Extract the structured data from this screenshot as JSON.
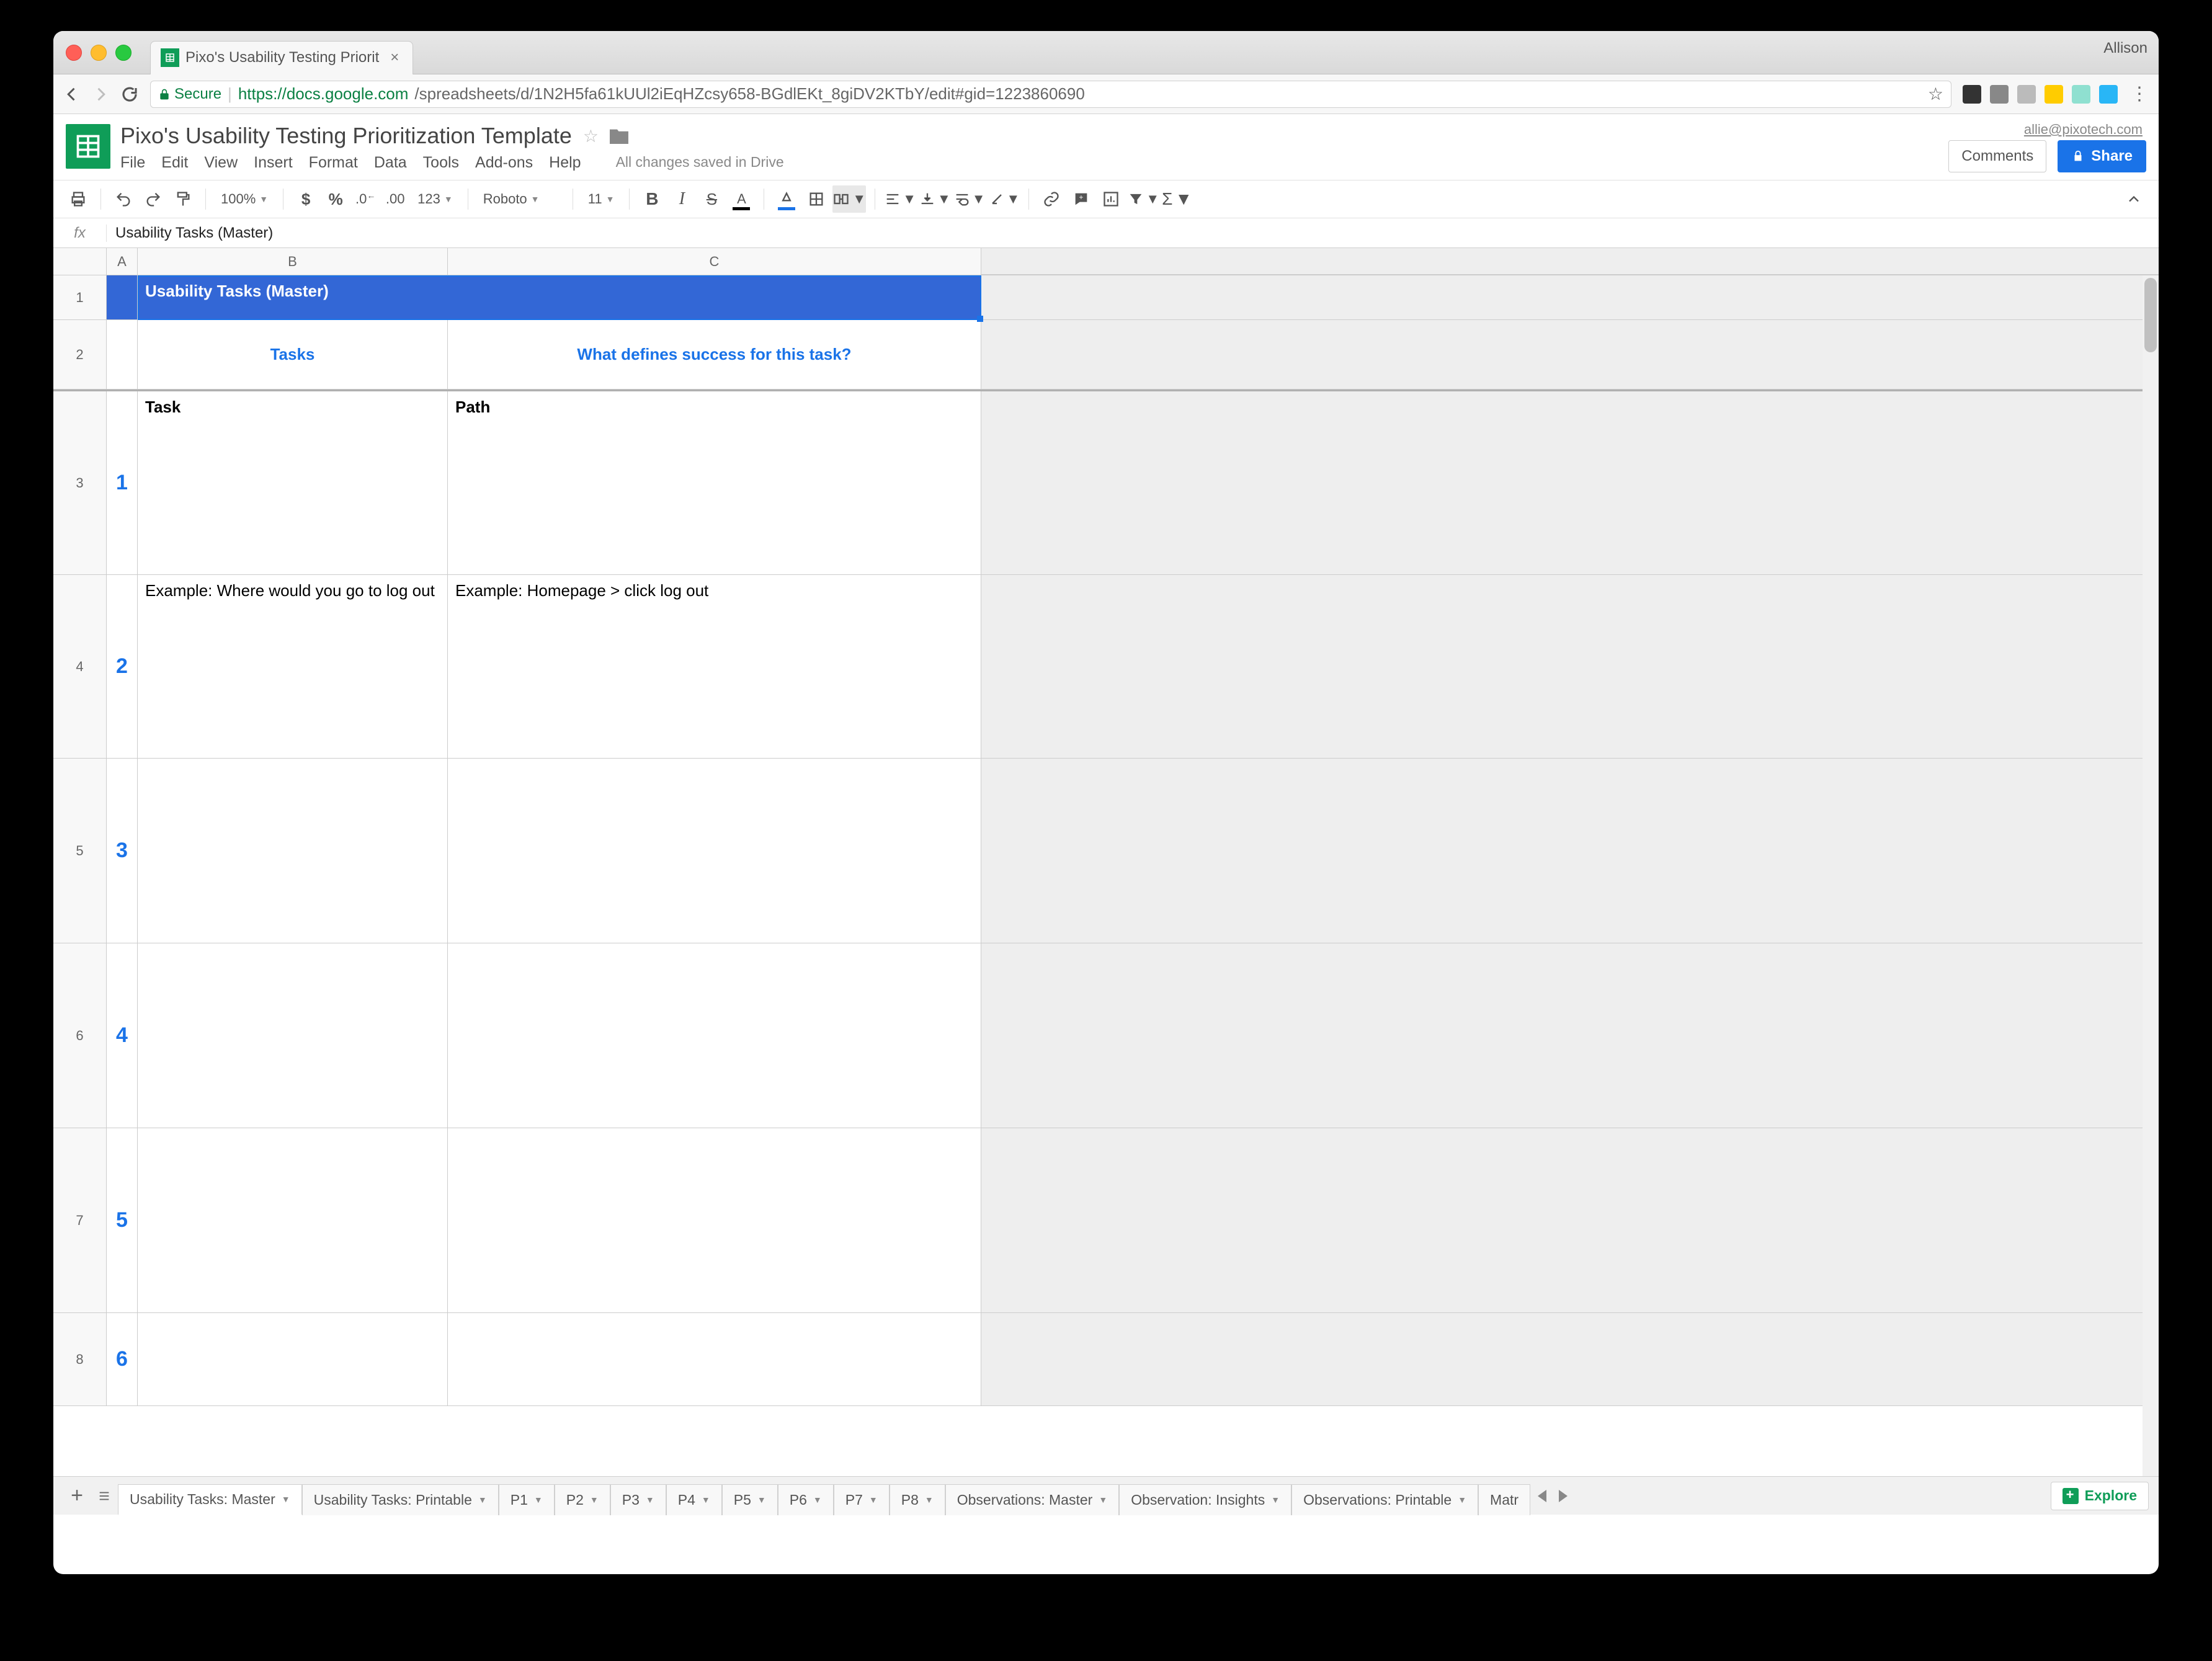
{
  "browser": {
    "user": "Allison",
    "tab_title": "Pixo's Usability Testing Priorit",
    "secure_label": "Secure",
    "url_host": "https://docs.google.com",
    "url_path": "/spreadsheets/d/1N2H5fa61kUUl2iEqHZcsy658-BGdlEKt_8giDV2KTbY/edit#gid=1223860690"
  },
  "sheets": {
    "doc_title": "Pixo's Usability Testing Prioritization Template",
    "user_email": "allie@pixotech.com",
    "comments_label": "Comments",
    "share_label": "Share",
    "save_status": "All changes saved in Drive",
    "menus": [
      "File",
      "Edit",
      "View",
      "Insert",
      "Format",
      "Data",
      "Tools",
      "Add-ons",
      "Help"
    ]
  },
  "toolbar": {
    "zoom": "100%",
    "font": "Roboto",
    "font_size": "11",
    "number_format": "123"
  },
  "formula": {
    "fx": "fx",
    "value": "Usability Tasks (Master)"
  },
  "columns": [
    "A",
    "B",
    "C"
  ],
  "rows": {
    "r1": {
      "num": "1",
      "merged": "Usability Tasks (Master)"
    },
    "r2": {
      "num": "2",
      "b": "Tasks",
      "c": "What defines success for this task?"
    },
    "r3": {
      "num": "3",
      "a": "1",
      "b": "Task",
      "c": "Path"
    },
    "r4": {
      "num": "4",
      "a": "2",
      "b": "Example: Where would you go to log out",
      "c": "Example: Homepage > click log out"
    },
    "r5": {
      "num": "5",
      "a": "3",
      "b": "",
      "c": ""
    },
    "r6": {
      "num": "6",
      "a": "4",
      "b": "",
      "c": ""
    },
    "r7": {
      "num": "7",
      "a": "5",
      "b": "",
      "c": ""
    },
    "r8": {
      "num": "8",
      "a": "6",
      "b": "",
      "c": ""
    }
  },
  "tabs": {
    "active": "Usability Tasks: Master",
    "list": [
      "Usability Tasks: Printable",
      "P1",
      "P2",
      "P3",
      "P4",
      "P5",
      "P6",
      "P7",
      "P8",
      "Observations: Master",
      "Observation: Insights",
      "Observations: Printable",
      "Matr"
    ],
    "explore": "Explore"
  }
}
